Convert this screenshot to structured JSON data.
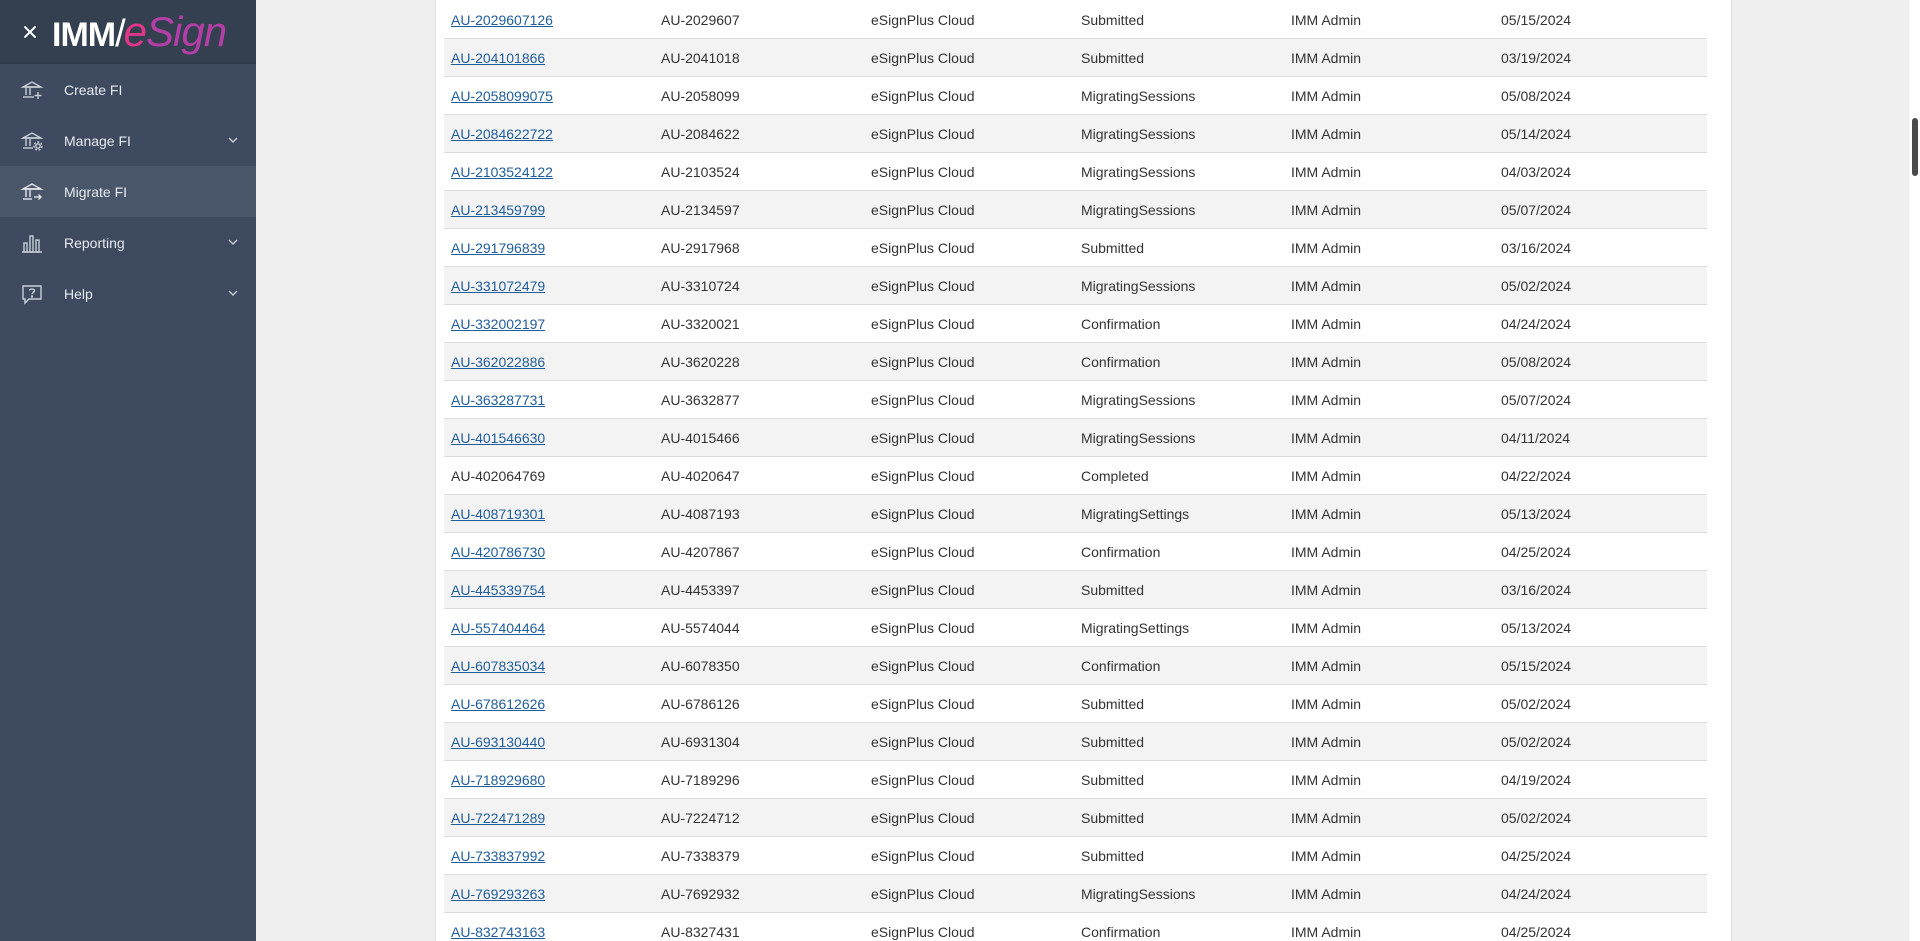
{
  "brand": {
    "imm": "IMM",
    "slash": "/",
    "esign_e": "e",
    "esign_rest": "Sign"
  },
  "sidebar": {
    "items": [
      {
        "label": "Create FI",
        "icon": "bank-plus-icon",
        "expandable": false
      },
      {
        "label": "Manage FI",
        "icon": "bank-gear-icon",
        "expandable": true
      },
      {
        "label": "Migrate FI",
        "icon": "bank-migrate-icon",
        "expandable": false,
        "active": true
      },
      {
        "label": "Reporting",
        "icon": "bar-chart-icon",
        "expandable": true
      },
      {
        "label": "Help",
        "icon": "help-bubble-icon",
        "expandable": true
      }
    ]
  },
  "table": {
    "rows": [
      {
        "id": "AU-2029607126",
        "code": "AU-2029607",
        "env": "eSignPlus Cloud",
        "status": "Submitted",
        "user": "IMM Admin",
        "date": "05/15/2024",
        "link": true
      },
      {
        "id": "AU-204101866",
        "code": "AU-2041018",
        "env": "eSignPlus Cloud",
        "status": "Submitted",
        "user": "IMM Admin",
        "date": "03/19/2024",
        "link": true
      },
      {
        "id": "AU-2058099075",
        "code": "AU-2058099",
        "env": "eSignPlus Cloud",
        "status": "MigratingSessions",
        "user": "IMM Admin",
        "date": "05/08/2024",
        "link": true
      },
      {
        "id": "AU-2084622722",
        "code": "AU-2084622",
        "env": "eSignPlus Cloud",
        "status": "MigratingSessions",
        "user": "IMM Admin",
        "date": "05/14/2024",
        "link": true
      },
      {
        "id": "AU-2103524122",
        "code": "AU-2103524",
        "env": "eSignPlus Cloud",
        "status": "MigratingSessions",
        "user": "IMM Admin",
        "date": "04/03/2024",
        "link": true
      },
      {
        "id": "AU-213459799",
        "code": "AU-2134597",
        "env": "eSignPlus Cloud",
        "status": "MigratingSessions",
        "user": "IMM Admin",
        "date": "05/07/2024",
        "link": true
      },
      {
        "id": "AU-291796839",
        "code": "AU-2917968",
        "env": "eSignPlus Cloud",
        "status": "Submitted",
        "user": "IMM Admin",
        "date": "03/16/2024",
        "link": true
      },
      {
        "id": "AU-331072479",
        "code": "AU-3310724",
        "env": "eSignPlus Cloud",
        "status": "MigratingSessions",
        "user": "IMM Admin",
        "date": "05/02/2024",
        "link": true
      },
      {
        "id": "AU-332002197",
        "code": "AU-3320021",
        "env": "eSignPlus Cloud",
        "status": "Confirmation",
        "user": "IMM Admin",
        "date": "04/24/2024",
        "link": true
      },
      {
        "id": "AU-362022886",
        "code": "AU-3620228",
        "env": "eSignPlus Cloud",
        "status": "Confirmation",
        "user": "IMM Admin",
        "date": "05/08/2024",
        "link": true
      },
      {
        "id": "AU-363287731",
        "code": "AU-3632877",
        "env": "eSignPlus Cloud",
        "status": "MigratingSessions",
        "user": "IMM Admin",
        "date": "05/07/2024",
        "link": true
      },
      {
        "id": "AU-401546630",
        "code": "AU-4015466",
        "env": "eSignPlus Cloud",
        "status": "MigratingSessions",
        "user": "IMM Admin",
        "date": "04/11/2024",
        "link": true
      },
      {
        "id": "AU-402064769",
        "code": "AU-4020647",
        "env": "eSignPlus Cloud",
        "status": "Completed",
        "user": "IMM Admin",
        "date": "04/22/2024",
        "link": false
      },
      {
        "id": "AU-408719301",
        "code": "AU-4087193",
        "env": "eSignPlus Cloud",
        "status": "MigratingSettings",
        "user": "IMM Admin",
        "date": "05/13/2024",
        "link": true
      },
      {
        "id": "AU-420786730",
        "code": "AU-4207867",
        "env": "eSignPlus Cloud",
        "status": "Confirmation",
        "user": "IMM Admin",
        "date": "04/25/2024",
        "link": true
      },
      {
        "id": "AU-445339754",
        "code": "AU-4453397",
        "env": "eSignPlus Cloud",
        "status": "Submitted",
        "user": "IMM Admin",
        "date": "03/16/2024",
        "link": true
      },
      {
        "id": "AU-557404464",
        "code": "AU-5574044",
        "env": "eSignPlus Cloud",
        "status": "MigratingSettings",
        "user": "IMM Admin",
        "date": "05/13/2024",
        "link": true
      },
      {
        "id": "AU-607835034",
        "code": "AU-6078350",
        "env": "eSignPlus Cloud",
        "status": "Confirmation",
        "user": "IMM Admin",
        "date": "05/15/2024",
        "link": true
      },
      {
        "id": "AU-678612626",
        "code": "AU-6786126",
        "env": "eSignPlus Cloud",
        "status": "Submitted",
        "user": "IMM Admin",
        "date": "05/02/2024",
        "link": true
      },
      {
        "id": "AU-693130440",
        "code": "AU-6931304",
        "env": "eSignPlus Cloud",
        "status": "Submitted",
        "user": "IMM Admin",
        "date": "05/02/2024",
        "link": true
      },
      {
        "id": "AU-718929680",
        "code": "AU-7189296",
        "env": "eSignPlus Cloud",
        "status": "Submitted",
        "user": "IMM Admin",
        "date": "04/19/2024",
        "link": true
      },
      {
        "id": "AU-722471289",
        "code": "AU-7224712",
        "env": "eSignPlus Cloud",
        "status": "Submitted",
        "user": "IMM Admin",
        "date": "05/02/2024",
        "link": true
      },
      {
        "id": "AU-733837992",
        "code": "AU-7338379",
        "env": "eSignPlus Cloud",
        "status": "Submitted",
        "user": "IMM Admin",
        "date": "04/25/2024",
        "link": true
      },
      {
        "id": "AU-769293263",
        "code": "AU-7692932",
        "env": "eSignPlus Cloud",
        "status": "MigratingSessions",
        "user": "IMM Admin",
        "date": "04/24/2024",
        "link": true
      },
      {
        "id": "AU-832743163",
        "code": "AU-8327431",
        "env": "eSignPlus Cloud",
        "status": "Confirmation",
        "user": "IMM Admin",
        "date": "04/25/2024",
        "link": true
      }
    ]
  },
  "colors": {
    "sidebar_bg": "#3d4a5f",
    "sidebar_active": "#4a566a",
    "link": "#1f5d9c",
    "brand_magenta": "#b33fa6",
    "brand_pink": "#e2368a"
  }
}
